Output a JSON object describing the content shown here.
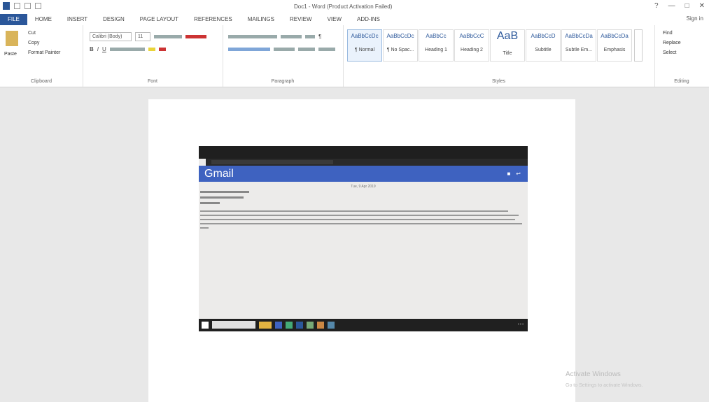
{
  "window": {
    "title": "Doc1 - Word (Product Activation Failed)",
    "controls": [
      "?",
      "—",
      "□",
      "✕"
    ]
  },
  "ribbon_tabs": [
    "FILE",
    "HOME",
    "INSERT",
    "DESIGN",
    "PAGE LAYOUT",
    "REFERENCES",
    "MAILINGS",
    "REVIEW",
    "VIEW",
    "ADD-INS"
  ],
  "signin": "Sign in",
  "clipboard": {
    "paste": "Paste",
    "cut": "Cut",
    "copy": "Copy",
    "format_painter": "Format Painter",
    "group": "Clipboard"
  },
  "font": {
    "name": "Calibri (Body)",
    "size": "11",
    "group": "Font"
  },
  "paragraph": {
    "group": "Paragraph"
  },
  "styles": {
    "items": [
      {
        "sample": "AaBbCcDc",
        "name": "¶ Normal"
      },
      {
        "sample": "AaBbCcDc",
        "name": "¶ No Spac..."
      },
      {
        "sample": "AaBbCc",
        "name": "Heading 1"
      },
      {
        "sample": "AaBbCcC",
        "name": "Heading 2"
      },
      {
        "sample": "AaB",
        "name": "Title"
      },
      {
        "sample": "AaBbCcD",
        "name": "Subtitle"
      },
      {
        "sample": "AaBbCcDa",
        "name": "Subtle Em..."
      },
      {
        "sample": "AaBbCcDa",
        "name": "Emphasis"
      }
    ],
    "group": "Styles"
  },
  "editing": {
    "find": "Find",
    "replace": "Replace",
    "select": "Select",
    "group": "Editing"
  },
  "embedded": {
    "app_title": "Gmail",
    "date": "Tue, 9 Apr 2019"
  },
  "watermark": {
    "title": "Activate Windows",
    "subtitle": "Go to Settings to activate Windows."
  }
}
